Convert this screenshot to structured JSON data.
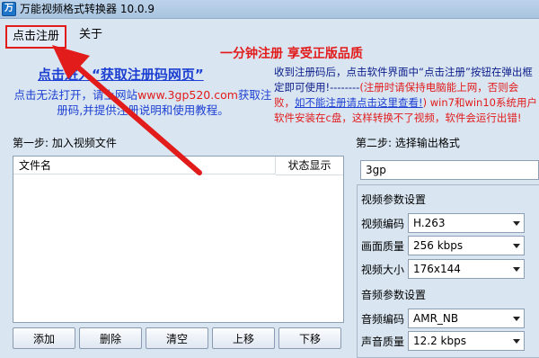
{
  "window": {
    "title": "万能视频格式转换器 10.0.9",
    "icon": "app-icon"
  },
  "menu": {
    "register": "点击注册",
    "about": "关于"
  },
  "promo": "一分钟注册 享受正版品质",
  "left": {
    "link": "点击进入“获取注册码网页”",
    "help_before": "点击无法打开，请上网站",
    "site": "www.3gp520.com",
    "help_after": "获取注册码,并提供注册说明和使用教程。"
  },
  "right_notice": {
    "line1": "收到注册码后，点击软件界面中“点击注册”按钮在弹出框",
    "line2_a": "定即可使用!--------",
    "line2_b": "(注册时请保持电脑能上网，否则会",
    "line3_a": "败，",
    "line3_link": "如不能注册请点击这里查看!",
    "line3_b": ") win7和win10系统用户",
    "line4": "软件安装在c盘，这样转换不了视频，软件会运行出错!"
  },
  "step1": {
    "label": "第一步: 加入视频文件",
    "col_name": "文件名",
    "col_status": "状态显示",
    "buttons": [
      "添加",
      "删除",
      "清空",
      "上移",
      "下移"
    ]
  },
  "step2": {
    "label": "第二步: 选择输出格式",
    "format": "3gp",
    "video_section": "视频参数设置",
    "video_codec_label": "视频编码",
    "video_codec": "H.263",
    "quality_label": "画面质量",
    "quality": "256 kbps",
    "size_label": "视频大小",
    "size": "176x144",
    "audio_section": "音频参数设置",
    "audio_codec_label": "音频编码",
    "audio_codec": "AMR_NB",
    "audio_quality_label": "声音质量",
    "audio_quality": "12.2 kbps"
  },
  "colors": {
    "accent_red": "#e21b1b",
    "link_blue": "#1d3fd2",
    "background": "#d9e6f2"
  }
}
